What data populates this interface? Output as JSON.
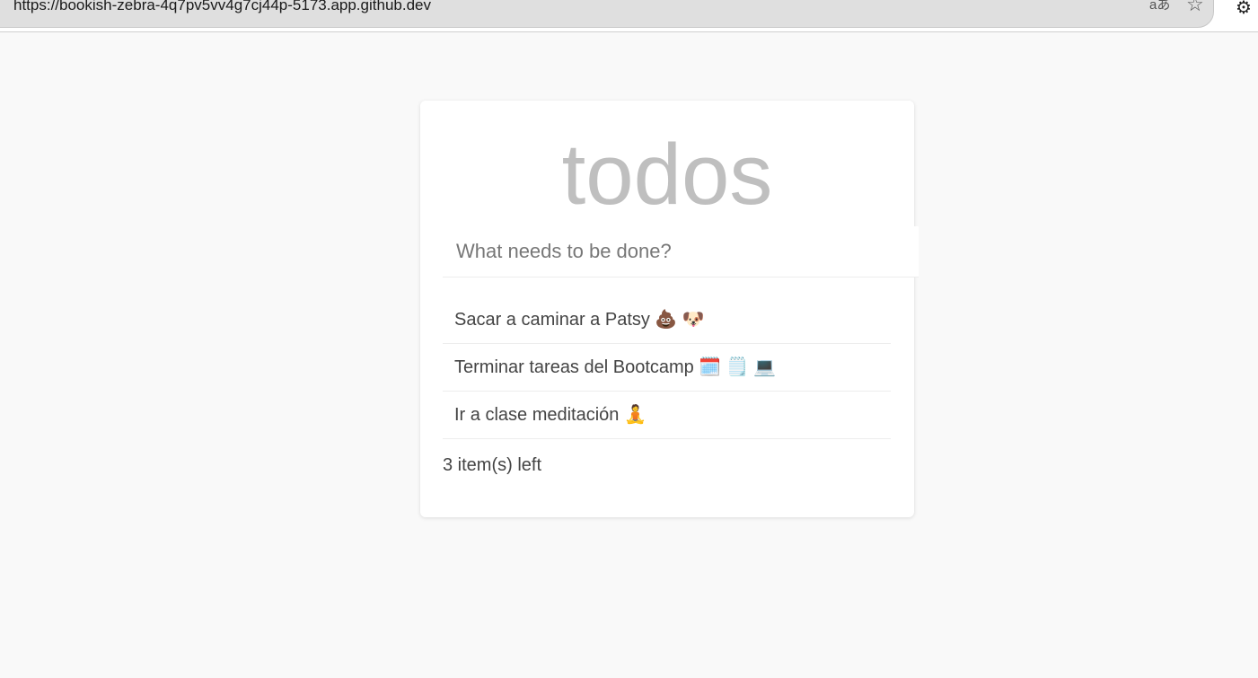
{
  "browser": {
    "url": "https://bookish-zebra-4q7pv5vv4g7cj44p-5173.app.github.dev",
    "translate_icon": "aあ",
    "favorite_icon": "☆",
    "extensions_icon": "⚙"
  },
  "app": {
    "title": "todos",
    "input_placeholder": "What needs to be done?",
    "todos": [
      {
        "text": "Sacar a caminar a Patsy 💩 🐶"
      },
      {
        "text": "Terminar tareas del Bootcamp 🗓️ 🗒️ 💻"
      },
      {
        "text": "Ir a clase meditación  🧘"
      }
    ],
    "footer": "3 item(s) left"
  }
}
